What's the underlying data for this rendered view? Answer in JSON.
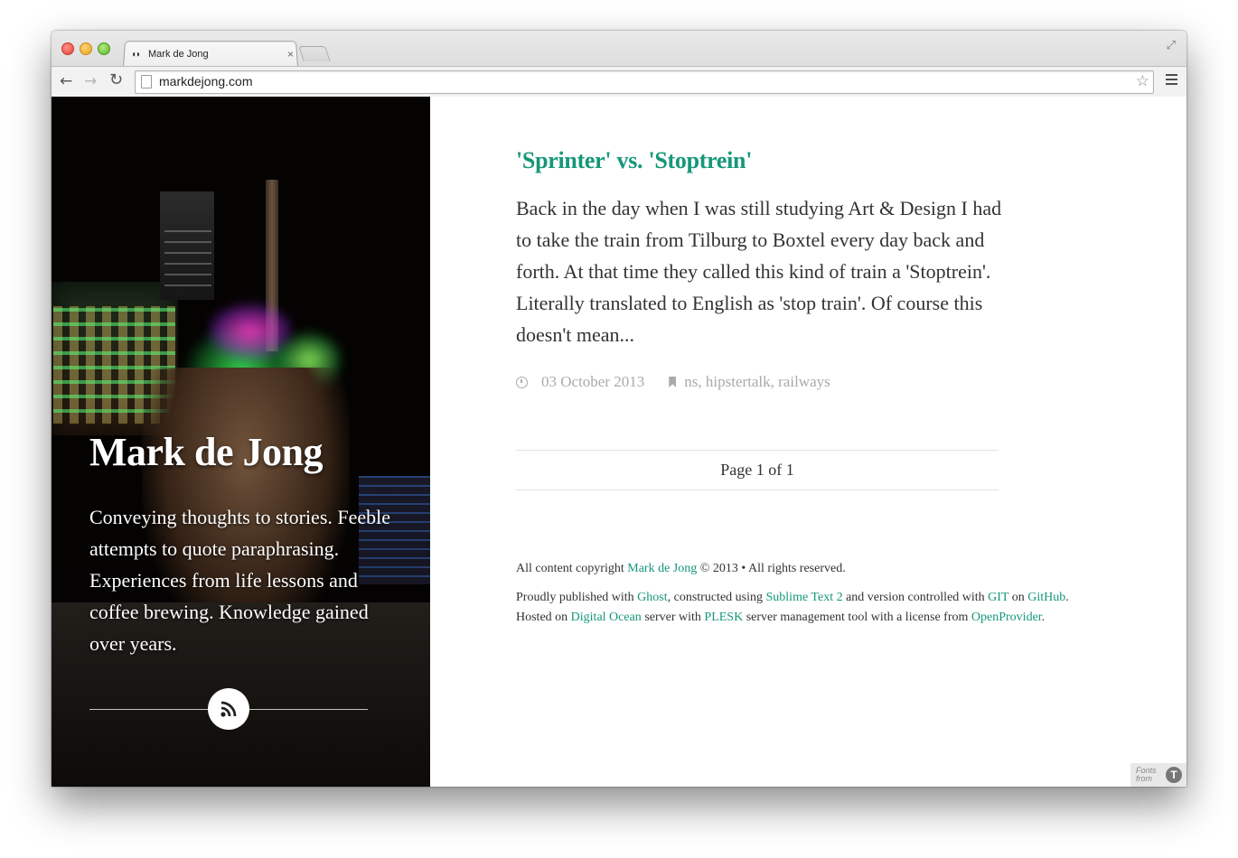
{
  "browser": {
    "tab_title": "Mark de Jong",
    "tab_favicon": "◖◗",
    "tab_close": "×",
    "url": "markdejong.com",
    "icons": {
      "back": "back-arrow-icon",
      "forward": "forward-arrow-icon",
      "reload": "reload-icon",
      "bookmark_star": "star-icon",
      "menu": "menu-icon",
      "fullscreen": "fullscreen-icon"
    }
  },
  "sidebar": {
    "title": "Mark de Jong",
    "description": "Conveying thoughts to stories. Feeble attempts to quote paraphrasing. Experiences from life lessons and coffee brewing. Knowledge gained over years.",
    "rss_icon": "rss-icon"
  },
  "post": {
    "title": "'Sprinter' vs. 'Stoptrein'",
    "excerpt": "Back in the day when I was still studying Art & Design I had to take the train from Tilburg to Boxtel every day back and forth. At that time they called this kind of train a 'Stoptrein'. Literally translated to English as 'stop train'. Of course this doesn't mean...",
    "date": "03 October 2013",
    "tags": "ns, hipstertalk, railways"
  },
  "pagination": {
    "label": "Page 1 of 1"
  },
  "footer": {
    "copyright_prefix": "All content copyright ",
    "copyright_link": "Mark de Jong",
    "copyright_suffix": " © 2013 • All rights reserved.",
    "line2": {
      "t1": "Proudly published with ",
      "ghost": "Ghost",
      "t2": ", constructed using ",
      "sublime": "Sublime Text 2",
      "t3": " and version controlled with ",
      "git": "GIT",
      "t4": " on ",
      "github": "GitHub",
      "t5": "."
    },
    "line3": {
      "t1": "Hosted on ",
      "digitalocean": "Digital Ocean",
      "t2": " server with ",
      "plesk": "PLESK",
      "t3": " server management tool with a license from ",
      "openprovider": "OpenProvider",
      "t4": "."
    }
  },
  "fonts_badge": {
    "line1": "Fonts",
    "line2": "from",
    "logo": "T"
  },
  "colors": {
    "accent": "#16977a",
    "meta_gray": "#aaaaaa",
    "text": "#333333"
  }
}
